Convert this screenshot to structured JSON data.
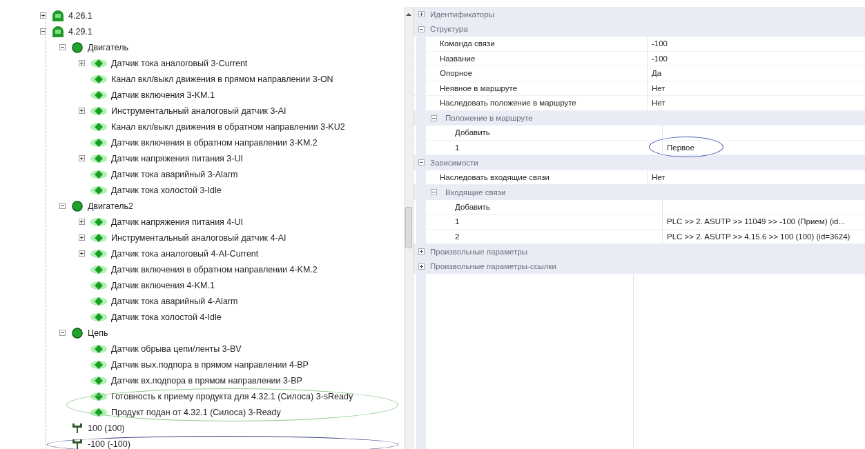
{
  "tree": [
    {
      "label": "4.26.1",
      "kind": "station",
      "expanded": false
    },
    {
      "label": "4.29.1",
      "kind": "station",
      "expanded": true,
      "children": [
        {
          "label": "Двигатель",
          "kind": "group",
          "expanded": true,
          "children": [
            {
              "label": "Датчик тока аналоговый 3-Current",
              "kind": "sensor",
              "expanded": false
            },
            {
              "label": "Канал вкл/выкл движения в прямом направлении 3-ON",
              "kind": "sensor"
            },
            {
              "label": "Датчик включения 3-KM.1",
              "kind": "sensor"
            },
            {
              "label": "Инструментальный аналоговый датчик 3-AI",
              "kind": "sensor",
              "expanded": false
            },
            {
              "label": "Канал вкл/выкл движения в обратном направлении 3-KU2",
              "kind": "sensor"
            },
            {
              "label": "Датчик включения в обратном направлении 3-KM.2",
              "kind": "sensor"
            },
            {
              "label": "Датчик напряжения питания 3-UI",
              "kind": "sensor",
              "expanded": false
            },
            {
              "label": "Датчик тока аварийный 3-Alarm",
              "kind": "sensor"
            },
            {
              "label": "Датчик тока холостой 3-Idle",
              "kind": "sensor"
            }
          ]
        },
        {
          "label": "Двигатель2",
          "kind": "group",
          "expanded": true,
          "children": [
            {
              "label": "Датчик напряжения питания 4-UI",
              "kind": "sensor",
              "expanded": false
            },
            {
              "label": "Инструментальный аналоговый датчик 4-AI",
              "kind": "sensor",
              "expanded": false
            },
            {
              "label": "Датчик тока аналоговый 4-AI-Current",
              "kind": "sensor",
              "expanded": false
            },
            {
              "label": "Датчик включения в обратном направлении 4-KM.2",
              "kind": "sensor"
            },
            {
              "label": "Датчик включения 4-KM.1",
              "kind": "sensor"
            },
            {
              "label": "Датчик тока аварийный 4-Alarm",
              "kind": "sensor"
            },
            {
              "label": "Датчик тока холостой 4-Idle",
              "kind": "sensor"
            }
          ]
        },
        {
          "label": "Цепь",
          "kind": "group",
          "expanded": true,
          "children": [
            {
              "label": "Датчик обрыва цепи/ленты 3-BV",
              "kind": "sensor"
            },
            {
              "label": "Датчик вых.подпора в прямом направлении 4-BP",
              "kind": "sensor"
            },
            {
              "label": "Датчик вх.подпора в прямом направлении 3-BP",
              "kind": "sensor"
            },
            {
              "label": "Готовность к приему продукта для 4.32.1 (Силоса) 3-sReady",
              "kind": "sensor",
              "circled": true,
              "color": "#8cc98c"
            },
            {
              "label": "Продукт подан от 4.32.1 (Силоса) 3-Ready",
              "kind": "sensor",
              "circled": true,
              "color": "#8cc98c"
            }
          ]
        },
        {
          "label": "100 (100)",
          "kind": "link"
        },
        {
          "label": "-100 (-100)",
          "kind": "link",
          "circled": true,
          "color": "#3a4680"
        }
      ]
    }
  ],
  "properties": [
    {
      "kind": "category",
      "label": "Идентификаторы",
      "expanded": false
    },
    {
      "kind": "category",
      "label": "Структура",
      "expanded": true,
      "rows": [
        {
          "kind": "property",
          "name": "Команда связи",
          "value": "-100"
        },
        {
          "kind": "property",
          "name": "Название",
          "value": "-100"
        },
        {
          "kind": "property",
          "name": "Опорное",
          "value": "Да"
        },
        {
          "kind": "property",
          "name": "Неявное в маршруте",
          "value": "Нет"
        },
        {
          "kind": "property",
          "name": "Наследовать положение в маршруте",
          "value": "Нет"
        },
        {
          "kind": "category",
          "label": "Положение в маршруте",
          "expanded": true,
          "rows": [
            {
              "kind": "property",
              "name": "Добавить"
            },
            {
              "kind": "property",
              "name": "1",
              "value": "Первое",
              "circled": true,
              "color": "#4656c0"
            }
          ]
        }
      ]
    },
    {
      "kind": "category",
      "label": "Зависимости",
      "expanded": true,
      "rows": [
        {
          "kind": "property",
          "name": "Наследовать входящие связи",
          "value": "Нет"
        },
        {
          "kind": "category",
          "label": "Входящие связи",
          "expanded": true,
          "rows": [
            {
              "kind": "property",
              "name": "Добавить"
            },
            {
              "kind": "property",
              "name": "1",
              "value": "PLC >> 2. ASUTP >> 11049 >> -100 (Прием) (id..."
            },
            {
              "kind": "property",
              "name": "2",
              "value": "PLC >> 2. ASUTP >> 4.15.6 >> 100 (100) (id=3624)"
            }
          ]
        }
      ]
    },
    {
      "kind": "category",
      "label": "Произвольные параметры",
      "expanded": false
    },
    {
      "kind": "category",
      "label": "Произвольные параметры-ссылки",
      "expanded": false
    }
  ]
}
